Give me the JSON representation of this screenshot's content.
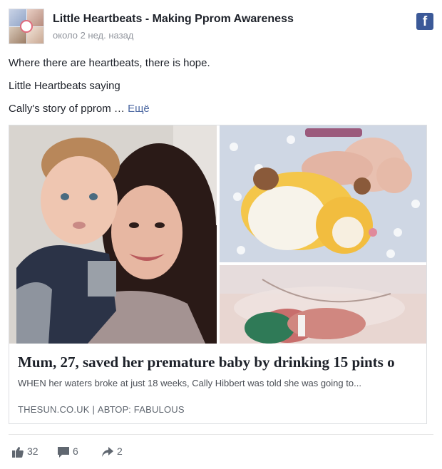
{
  "post": {
    "page_name": "Little Heartbeats - Making Pprom Awareness",
    "timestamp": "около 2 нед. назад",
    "platform_icon": "facebook-icon",
    "lines": [
      "Where there are heartbeats, there is hope.",
      "Little Heartbeats saying",
      "Cally's story of pprom …"
    ],
    "see_more": "Ещё"
  },
  "link_card": {
    "title": "Mum, 27, saved her premature baby by drinking 15 pints o",
    "description": "WHEN her waters broke at just 18 weeks, Cally Hibbert was told she was going to...",
    "source": "THESUN.CO.UK | АВТОР: FABULOUS"
  },
  "stats": {
    "likes": "32",
    "comments": "6",
    "shares": "2"
  },
  "colors": {
    "facebook_blue": "#3b5998",
    "link": "#4b67a1",
    "muted_text": "#90949c",
    "icon_gray": "#606770"
  }
}
